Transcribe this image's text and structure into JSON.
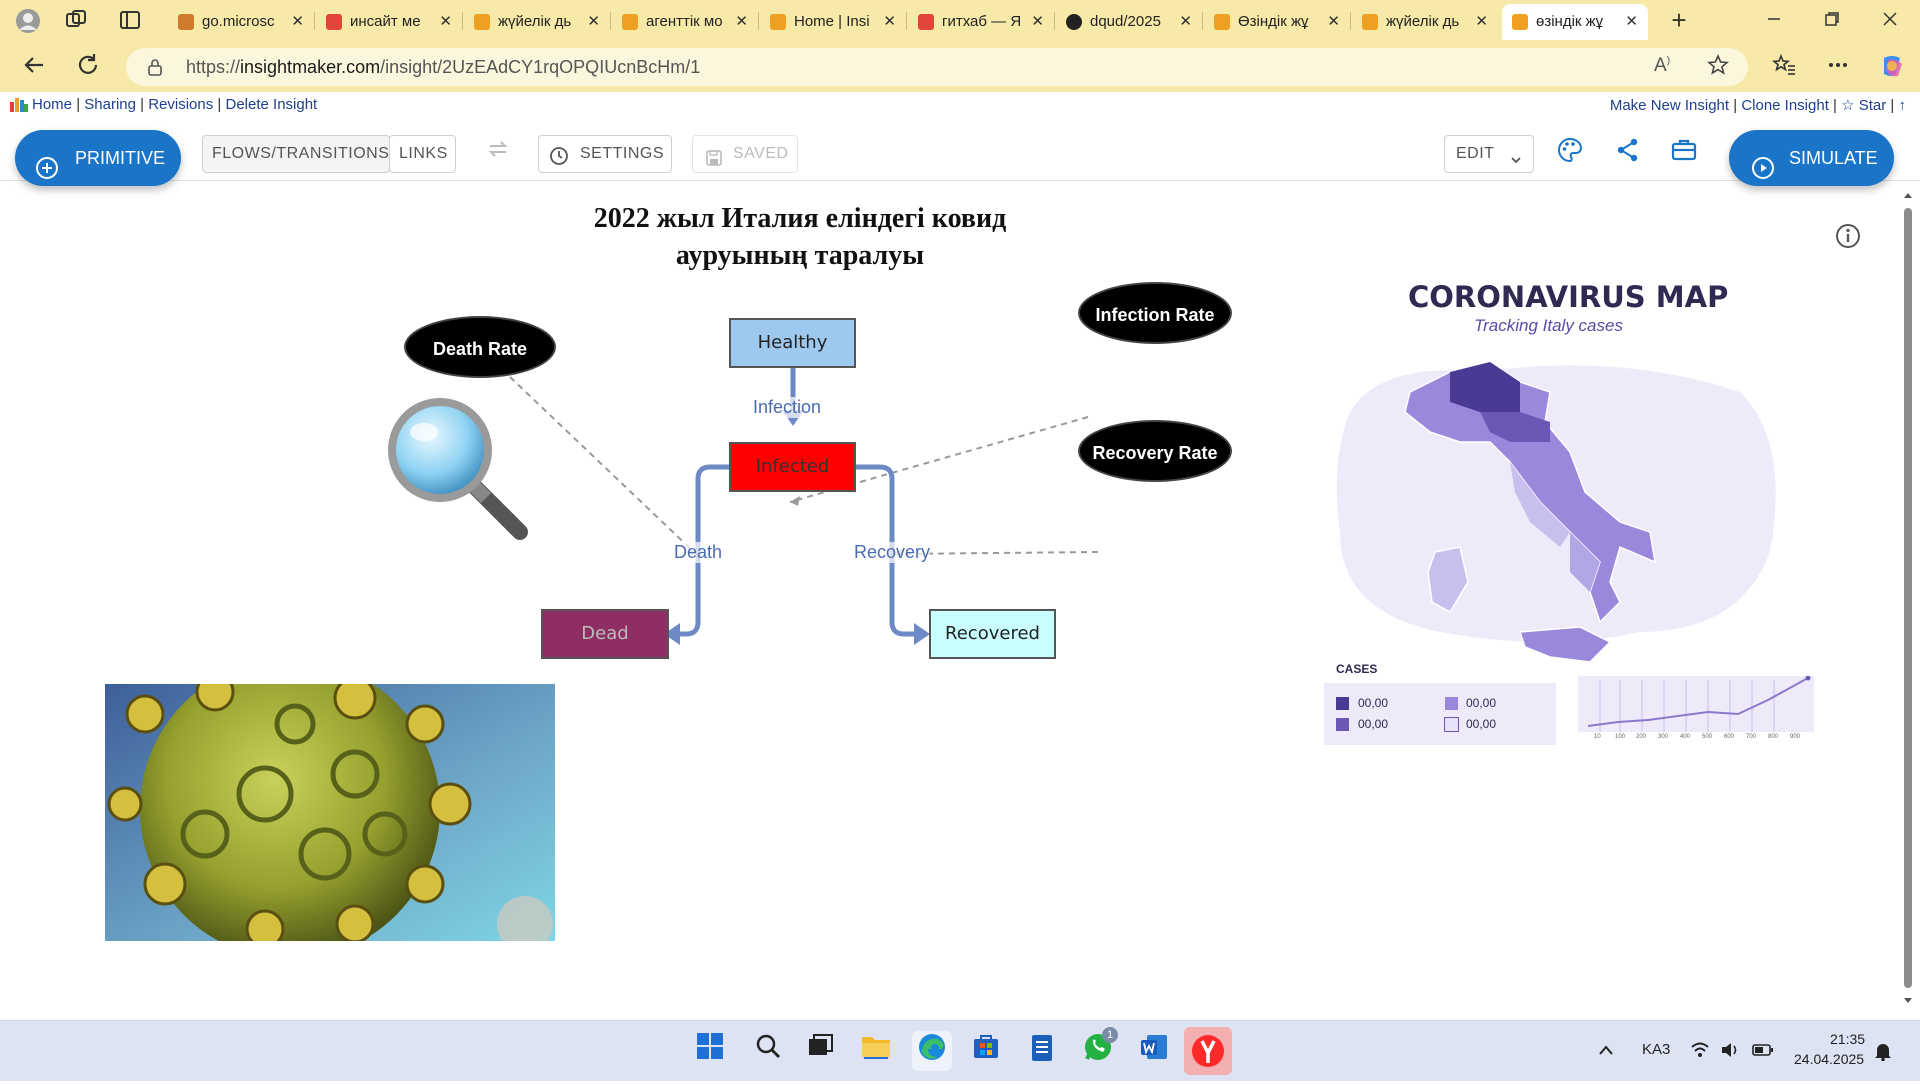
{
  "browser": {
    "tabs": [
      {
        "label": "go.microsc",
        "color": "#d07a2c"
      },
      {
        "label": "инсайт ме",
        "color": "#e0453a"
      },
      {
        "label": "жүйелік дь",
        "color": "#f0a020"
      },
      {
        "label": "агенттік мо",
        "color": "#f0a020"
      },
      {
        "label": "Home | Insi",
        "color": "#f0a020"
      },
      {
        "label": "гитхаб — Я",
        "color": "#e0453a"
      },
      {
        "label": "dqud/2025",
        "color": "#222222"
      },
      {
        "label": "Өзіндік жұ",
        "color": "#f0a020"
      },
      {
        "label": "жүйелік дь",
        "color": "#f0a020"
      },
      {
        "label": "өзіндік жұ",
        "color": "#f0a020"
      }
    ],
    "url_prefix": "https://",
    "url_host": "insightmaker.com",
    "url_path": "/insight/2UzEAdCY1rqOPQIUcnBcHm/1",
    "tab_close": "✕",
    "new_tab": "+"
  },
  "site": {
    "left_links": [
      "Home",
      "Sharing",
      "Revisions",
      "Delete Insight"
    ],
    "right_links": [
      "Make New Insight",
      "Clone Insight",
      "☆ Star",
      "↑"
    ]
  },
  "toolbar": {
    "primitive": "PRIMITIVE",
    "flows": "FLOWS/TRANSITIONS",
    "links": "LINKS",
    "settings": "SETTINGS",
    "saved": "SAVED",
    "edit": "EDIT",
    "simulate": "SIMULATE"
  },
  "diagram": {
    "title_line1": "2022 жыл Италия еліндегі ковид",
    "title_line2": "ауруының таралуы",
    "stocks": {
      "healthy": {
        "label": "Healthy",
        "color": "#9ec9ef"
      },
      "infected": {
        "label": "Infected",
        "color": "#ff0000"
      },
      "dead": {
        "label": "Dead",
        "color": "#8e2e62"
      },
      "recovered": {
        "label": "Recovered",
        "color": "#c9ffff"
      }
    },
    "variables": {
      "death_rate": "Death Rate",
      "infection_rate": "Infection Rate",
      "recovery_rate": "Recovery Rate"
    },
    "flows": {
      "infection": "Infection",
      "death": "Death",
      "recovery": "Recovery"
    }
  },
  "map_card": {
    "title": "CORONAVIRUS MAP",
    "subtitle": "Tracking Italy cases",
    "cases_label": "CASES",
    "legend": [
      "00,00",
      "00,00",
      "00,00",
      "00,00"
    ],
    "legend_colors": [
      "#4a3a94",
      "#9a88dc",
      "#6a58b4",
      "#e6e0f8"
    ],
    "axis_ticks": [
      "10",
      "100",
      "200",
      "300",
      "400",
      "500",
      "600",
      "700",
      "800",
      "900"
    ]
  },
  "taskbar": {
    "lang": "KA3",
    "time": "21:35",
    "date": "24.04.2025",
    "whatsapp_badge": "1"
  }
}
